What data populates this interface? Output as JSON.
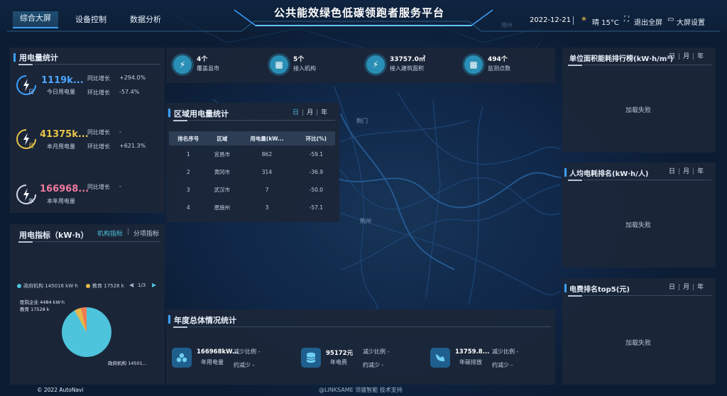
{
  "header": {
    "title": "公共能效绿色低碳领跑者服务平台",
    "tabs": [
      "综合大屏",
      "设备控制",
      "数据分析"
    ],
    "date": "2022-12-21",
    "weather": "晴 15°C",
    "exit_fullscreen": "退出全屏",
    "screen_settings": "大屏设置"
  },
  "colors": {
    "accent": "#3aa0ff",
    "teal": "#2a8fb6",
    "gold": "#e8c447",
    "pink": "#f07a9e",
    "cyan": "#4ec3dc"
  },
  "electricity": {
    "title": "用电量统计",
    "items": [
      {
        "badge": "日",
        "value": "1119k...",
        "label": "今日用电量",
        "yoy_label": "同比增长",
        "yoy": "+294.0%",
        "mom_label": "环比增长",
        "mom": "-57.4%"
      },
      {
        "badge": "月",
        "value": "41375k...",
        "label": "本月用电量",
        "yoy_label": "同比增长",
        "yoy": "-",
        "mom_label": "环比增长",
        "mom": "+621.3%"
      },
      {
        "badge": "年",
        "value": "166968...",
        "label": "本年用电量",
        "yoy_label": "同比增长",
        "yoy": "-"
      }
    ]
  },
  "indicator": {
    "title": "用电指标（kW·h）",
    "tab_active": "机构指标",
    "tab_other": "分项指标",
    "legend": [
      {
        "name": "政府机构",
        "value": "145016 kW·h",
        "color": "#4ec3dc"
      },
      {
        "name": "教育",
        "value": "17528 k",
        "color": "#e8b84a"
      }
    ],
    "pager": "1/3",
    "pie_labels": {
      "top": "医院企业  4484 kW·h",
      "second": "教育  17528 k",
      "bottom": "政府机构  14501..."
    }
  },
  "stats": [
    {
      "value": "4个",
      "label": "覆盖县市"
    },
    {
      "value": "5个",
      "label": "接入机构"
    },
    {
      "value": "33757.0㎡",
      "label": "接入建筑面积"
    },
    {
      "value": "494个",
      "label": "监测点数"
    }
  ],
  "region": {
    "title": "区域用电量统计",
    "periods": [
      "日",
      "月",
      "年"
    ],
    "columns": [
      "排名序号",
      "区域",
      "用电量(kW...",
      "环比(%)"
    ],
    "rows": [
      [
        "1",
        "宜昌市",
        "862",
        "-59.1"
      ],
      [
        "2",
        "黄冈市",
        "314",
        "-36.9"
      ],
      [
        "3",
        "武汉市",
        "7",
        "-50.0"
      ],
      [
        "4",
        "恩施州",
        "3",
        "-57.1"
      ]
    ]
  },
  "annual": {
    "title": "年度总体情况统计",
    "items": [
      {
        "value": "166968kW...",
        "label": "年用电量",
        "r1": "减少比例",
        "v1": "-",
        "r2": "约减少",
        "v2": "-"
      },
      {
        "value": "95172元",
        "label": "年电费",
        "r1": "减少比例",
        "v1": "-",
        "r2": "约减少",
        "v2": "-"
      },
      {
        "value": "13759.8...",
        "label": "年碳排放",
        "r1": "减少比例",
        "v1": "-",
        "r2": "约减少",
        "v2": "-"
      }
    ]
  },
  "right_panels": [
    {
      "title": "单位面积能耗排行榜(kW·h/m²)",
      "status": "加载失败",
      "periods": [
        "日",
        "月",
        "年"
      ]
    },
    {
      "title": "人均电耗排名(kW·h/人)",
      "status": "加载失败",
      "periods": [
        "日",
        "月",
        "年"
      ]
    },
    {
      "title": "电费排名top5(元)",
      "status": "加载失败",
      "periods": [
        "日",
        "月",
        "年"
      ]
    }
  ],
  "map_labels": [
    "随州",
    "荆门",
    "荆州"
  ],
  "footer": {
    "copyright": "© 2022 AutoNavi",
    "support": "@LINKSAME 邻盛智能 技术支持"
  }
}
